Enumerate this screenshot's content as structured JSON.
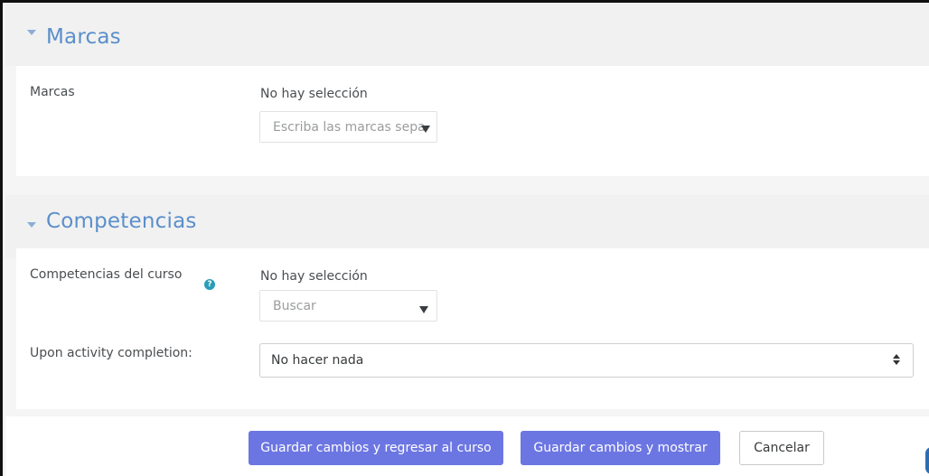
{
  "sections": {
    "marcas": {
      "title": "Marcas",
      "field_label": "Marcas",
      "selection_text": "No hay selección",
      "input_placeholder": "Escriba las marcas sepa"
    },
    "competencias": {
      "title": "Competencias",
      "field_label": "Competencias del curso",
      "selection_text": "No hay selección",
      "search_placeholder": "Buscar",
      "completion_label": "Upon activity completion:",
      "completion_value": "No hacer nada"
    }
  },
  "buttons": {
    "save_return": "Guardar cambios y regresar al curso",
    "save_show": "Guardar cambios y mostrar",
    "cancel": "Cancelar"
  },
  "icons": {
    "section_toggle": "caret-down-icon",
    "help": "question-circle-icon",
    "dropdown": "caret-down-icon",
    "select_arrows": "sort-icon"
  },
  "colors": {
    "section_title": "#5b8fcb",
    "primary_button": "#6c76e2",
    "help_icon": "#2a9db9"
  }
}
